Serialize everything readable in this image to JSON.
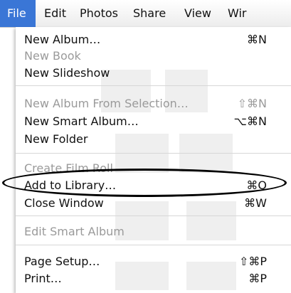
{
  "menubar": {
    "items": [
      "File",
      "Edit",
      "Photos",
      "Share",
      "View",
      "Wir"
    ]
  },
  "menu": {
    "items": [
      {
        "label": "New Album…",
        "shortcut": "⌘N",
        "enabled": true
      },
      {
        "label": "New Book",
        "shortcut": "",
        "enabled": false
      },
      {
        "label": "New Slideshow",
        "shortcut": "",
        "enabled": true
      },
      {
        "label": "New Album From Selection…",
        "shortcut": "⇧⌘N",
        "enabled": false
      },
      {
        "label": "New Smart Album…",
        "shortcut": "⌥⌘N",
        "enabled": true
      },
      {
        "label": "New Folder",
        "shortcut": "",
        "enabled": true
      },
      {
        "label": "Create Film Roll",
        "shortcut": "",
        "enabled": false
      },
      {
        "label": "Add to Library…",
        "shortcut": "⌘O",
        "enabled": true
      },
      {
        "label": "Close Window",
        "shortcut": "⌘W",
        "enabled": true
      },
      {
        "label": "Edit Smart Album",
        "shortcut": "",
        "enabled": false
      },
      {
        "label": "Page Setup…",
        "shortcut": "⇧⌘P",
        "enabled": true
      },
      {
        "label": "Print…",
        "shortcut": "⌘P",
        "enabled": true
      }
    ]
  },
  "colors": {
    "menubar_highlight": "#3a76d6",
    "disabled_text": "#9a9a9a",
    "annotation": "#000000"
  }
}
